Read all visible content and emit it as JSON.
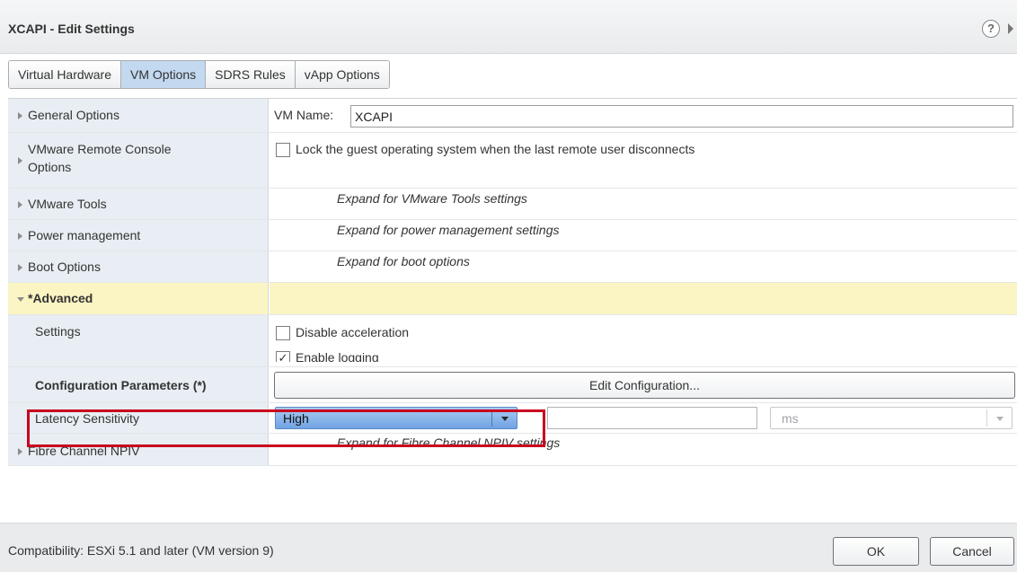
{
  "window": {
    "title": "XCAPI - Edit Settings"
  },
  "tabs": [
    {
      "label": "Virtual Hardware",
      "active": false
    },
    {
      "label": "VM Options",
      "active": true
    },
    {
      "label": "SDRS Rules",
      "active": false
    },
    {
      "label": "vApp Options",
      "active": false
    }
  ],
  "rows": {
    "general": {
      "label": "General Options",
      "vm_name_label": "VM Name:",
      "vm_name_value": "XCAPI"
    },
    "remote_console": {
      "label_line1": "VMware Remote Console",
      "label_line2": "Options",
      "checkbox_text": "Lock the guest operating system when the last remote user disconnects",
      "checked": false
    },
    "vmware_tools": {
      "label": "VMware Tools",
      "hint": "Expand for VMware Tools settings"
    },
    "power": {
      "label": "Power management",
      "hint": "Expand for power management settings"
    },
    "boot": {
      "label": "Boot Options",
      "hint": "Expand for boot options"
    },
    "advanced": {
      "label": "*Advanced"
    },
    "settings": {
      "label": "Settings",
      "disable_acceleration": "Disable acceleration",
      "enable_logging": "Enable logging"
    },
    "config_params": {
      "label": "Configuration Parameters (*)",
      "button": "Edit Configuration..."
    },
    "latency": {
      "label": "Latency Sensitivity",
      "selected": "High",
      "unit": "ms"
    },
    "fibre": {
      "label": "Fibre Channel NPIV",
      "hint": "Expand for Fibre Channel NPIV settings"
    }
  },
  "footer": {
    "compatibility": "Compatibility: ESXi 5.1 and later (VM version 9)",
    "ok": "OK",
    "cancel": "Cancel"
  },
  "colors": {
    "highlight": "#c8001e",
    "active_tab": "#c3d9f0",
    "advanced_row": "#fbf5c3",
    "select_high": "#6fa3e3"
  },
  "icons": {
    "help": "help-icon",
    "collapse": "collapse-icon"
  }
}
